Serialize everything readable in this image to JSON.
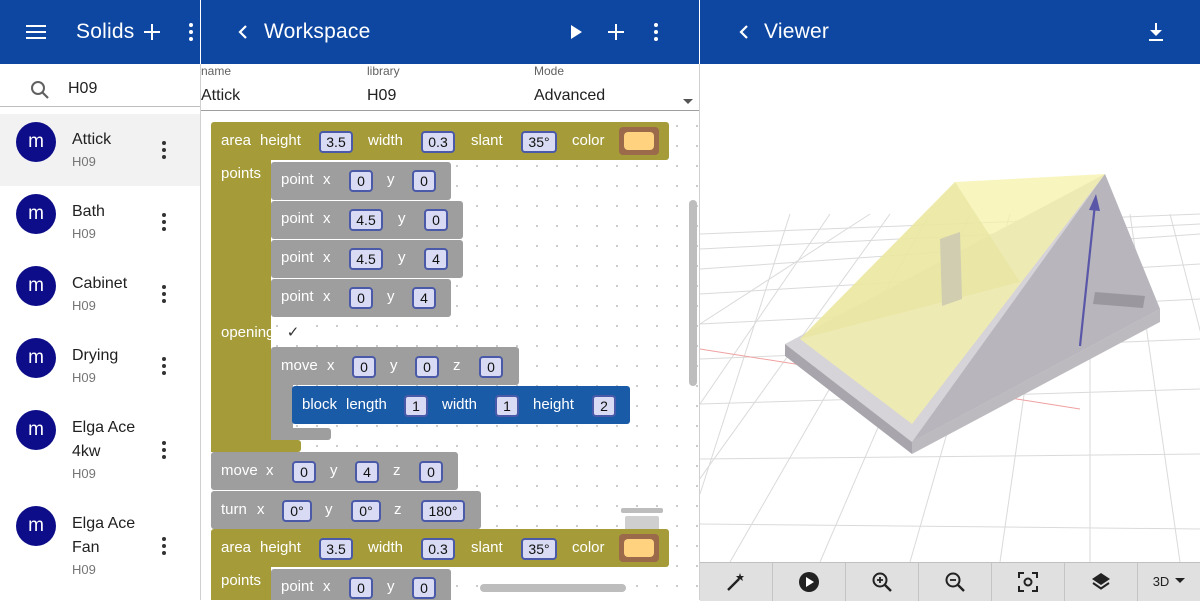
{
  "solids_bar": {
    "title": "Solids"
  },
  "workspace_bar": {
    "title": "Workspace"
  },
  "viewer_bar": {
    "title": "Viewer"
  },
  "search": {
    "value": "H09"
  },
  "solids": [
    {
      "title": "Attick",
      "subtitle": "H09",
      "avatar": "m",
      "selected": true
    },
    {
      "title": "Bath",
      "subtitle": "H09",
      "avatar": "m"
    },
    {
      "title": "Cabinet",
      "subtitle": "H09",
      "avatar": "m"
    },
    {
      "title": "Drying",
      "subtitle": "H09",
      "avatar": "m"
    },
    {
      "title_line1": "Elga Ace",
      "title_line2": "4kw",
      "subtitle": "H09",
      "avatar": "m"
    },
    {
      "title_line1": "Elga Ace",
      "title_line2": "Fan",
      "subtitle": "H09",
      "avatar": "m"
    }
  ],
  "form": {
    "name_label": "name",
    "name_value": "Attick",
    "library_label": "library",
    "library_value": "H09",
    "mode_label": "Mode",
    "mode_value": "Advanced"
  },
  "blocks": {
    "area1": {
      "kw": "area",
      "height_label": "height",
      "height": "3.5",
      "width_label": "width",
      "width": "0.3",
      "slant_label": "slant",
      "slant": "35°",
      "color_label": "color",
      "color": "#ffd27f"
    },
    "points_label": "points",
    "points": [
      {
        "kw": "point",
        "x_label": "x",
        "x": "0",
        "y_label": "y",
        "y": "0"
      },
      {
        "kw": "point",
        "x_label": "x",
        "x": "4.5",
        "y_label": "y",
        "y": "0"
      },
      {
        "kw": "point",
        "x_label": "x",
        "x": "4.5",
        "y_label": "y",
        "y": "4"
      },
      {
        "kw": "point",
        "x_label": "x",
        "x": "0",
        "y_label": "y",
        "y": "4"
      }
    ],
    "openings_label": "openings",
    "openings_check": "✓",
    "move1": {
      "kw": "move",
      "x_label": "x",
      "x": "0",
      "y_label": "y",
      "y": "0",
      "z_label": "z",
      "z": "0"
    },
    "block1": {
      "kw": "block",
      "length_label": "length",
      "length": "1",
      "width_label": "width",
      "width": "1",
      "height_label": "height",
      "height": "2"
    },
    "move2": {
      "kw": "move",
      "x_label": "x",
      "x": "0",
      "y_label": "y",
      "y": "4",
      "z_label": "z",
      "z": "0"
    },
    "turn1": {
      "kw": "turn",
      "x_label": "x",
      "x": "0°",
      "y_label": "y",
      "y": "0°",
      "z_label": "z",
      "z": "180°"
    },
    "area2": {
      "kw": "area",
      "height_label": "height",
      "height": "3.5",
      "width_label": "width",
      "width": "0.3",
      "slant_label": "slant",
      "slant": "35°",
      "color_label": "color",
      "color": "#ffd27f"
    },
    "points2_label": "points",
    "point5": {
      "kw": "point",
      "x_label": "x",
      "x": "0",
      "y_label": "y",
      "y": "0"
    }
  },
  "viewer_toolbar": {
    "mode": "3D"
  },
  "colors": {
    "appbar": "#0d47a1",
    "area_block": "#a59c39",
    "point_block": "#9e9e9e",
    "block_block": "#1a5ba8",
    "avatar": "#0d0d8a"
  }
}
